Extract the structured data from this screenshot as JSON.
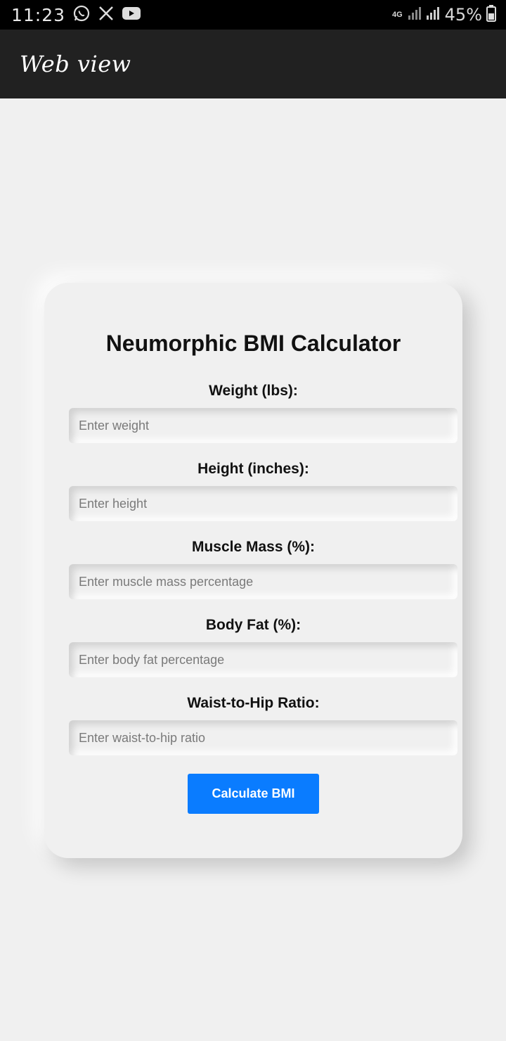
{
  "status_bar": {
    "time": "11:23",
    "network": "4G",
    "battery": "45%",
    "icons": [
      "whatsapp-icon",
      "x-icon",
      "youtube-icon",
      "signal-icon",
      "battery-icon"
    ]
  },
  "app_bar": {
    "title": "Web view"
  },
  "calculator": {
    "title": "Neumorphic BMI Calculator",
    "fields": [
      {
        "label": "Weight (lbs):",
        "placeholder": "Enter weight",
        "value": ""
      },
      {
        "label": "Height (inches):",
        "placeholder": "Enter height",
        "value": ""
      },
      {
        "label": "Muscle Mass (%):",
        "placeholder": "Enter muscle mass percentage",
        "value": ""
      },
      {
        "label": "Body Fat (%):",
        "placeholder": "Enter body fat percentage",
        "value": ""
      },
      {
        "label": "Waist-to-Hip Ratio:",
        "placeholder": "Enter waist-to-hip ratio",
        "value": ""
      }
    ],
    "button_label": "Calculate BMI"
  },
  "colors": {
    "accent": "#0a7cff",
    "background": "#f0f0f0",
    "app_bar": "#212121"
  }
}
